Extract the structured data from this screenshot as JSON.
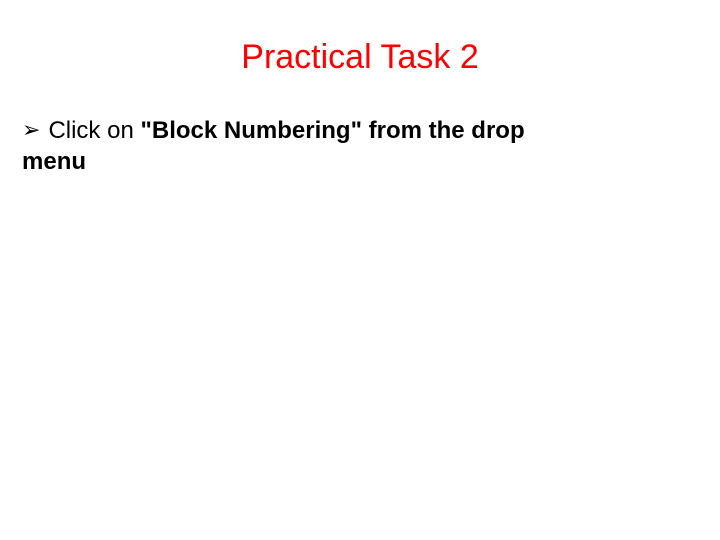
{
  "slide": {
    "title": "Practical Task 2",
    "bullet": {
      "icon": "➢",
      "prefix": " Click on ",
      "quoted_open": "\"",
      "quoted_text": "Block Numbering",
      "quoted_close": "\"",
      "middle": " from the drop ",
      "continuation": "menu"
    }
  }
}
